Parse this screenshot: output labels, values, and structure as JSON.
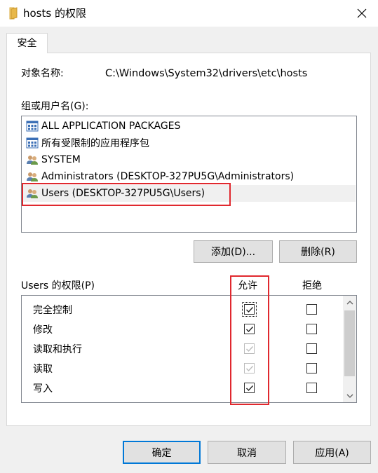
{
  "window": {
    "title": "hosts 的权限",
    "close_label": "✕"
  },
  "tabs": [
    {
      "label": "安全"
    }
  ],
  "object": {
    "label": "对象名称:",
    "value": "C:\\Windows\\System32\\drivers\\etc\\hosts"
  },
  "groups": {
    "label": "组或用户名(G):",
    "items": [
      {
        "label": "ALL APPLICATION PACKAGES",
        "icon": "app-package-icon"
      },
      {
        "label": "所有受限制的应用程序包",
        "icon": "app-package-icon"
      },
      {
        "label": "SYSTEM",
        "icon": "users-group-icon"
      },
      {
        "label": "Administrators (DESKTOP-327PU5G\\Administrators)",
        "icon": "users-group-icon"
      },
      {
        "label": "Users (DESKTOP-327PU5G\\Users)",
        "icon": "users-group-icon",
        "selected": true
      }
    ],
    "add_button": "添加(D)...",
    "remove_button": "删除(R)"
  },
  "permissions": {
    "label": "Users 的权限(P)",
    "allow_header": "允许",
    "deny_header": "拒绝",
    "rows": [
      {
        "name": "完全控制",
        "allow": true,
        "allow_inherited": false,
        "deny": false
      },
      {
        "name": "修改",
        "allow": true,
        "allow_inherited": false,
        "deny": false
      },
      {
        "name": "读取和执行",
        "allow": true,
        "allow_inherited": true,
        "deny": false
      },
      {
        "name": "读取",
        "allow": true,
        "allow_inherited": true,
        "deny": false
      },
      {
        "name": "写入",
        "allow": true,
        "allow_inherited": false,
        "deny": false
      }
    ]
  },
  "footer": {
    "ok": "确定",
    "cancel": "取消",
    "apply": "应用(A)"
  },
  "colors": {
    "highlight": "#e0282e",
    "accent": "#0078d7",
    "folder": "#e8b84a"
  }
}
